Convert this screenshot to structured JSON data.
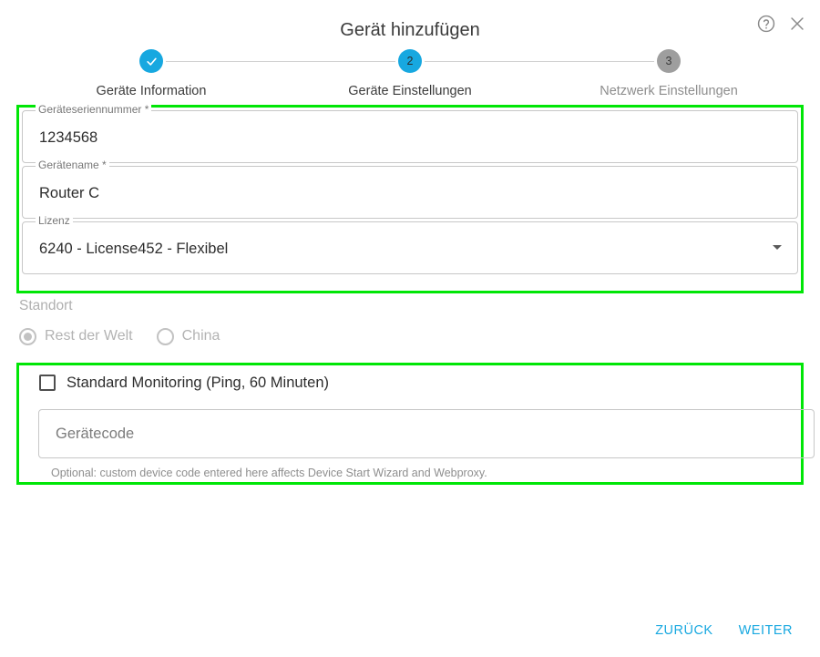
{
  "dialog": {
    "title": "Gerät hinzufügen",
    "help_icon": "help-circle-icon",
    "close_icon": "close-icon"
  },
  "colors": {
    "accent_blue": "#17a8e0",
    "highlight_green": "#00e606",
    "inactive_gray": "#9e9e9e",
    "disabled_text": "#b3b3b3"
  },
  "stepper": {
    "steps": [
      {
        "number": "1",
        "label": "Geräte Information",
        "state": "done",
        "glyph": "check-icon"
      },
      {
        "number": "2",
        "label": "Geräte Einstellungen",
        "state": "active",
        "glyph": "2"
      },
      {
        "number": "3",
        "label": "Netzwerk Einstellungen",
        "state": "todo",
        "glyph": "3"
      }
    ]
  },
  "device_group": {
    "serial": {
      "label": "Geräteseriennummer *",
      "value": "1234568",
      "placeholder": ""
    },
    "name": {
      "label": "Gerätename *",
      "value": "Router C",
      "placeholder": ""
    },
    "license": {
      "label": "Lizenz",
      "value": "6240 - License452 - Flexibel",
      "arrow_icon": "chevron-down-icon"
    }
  },
  "location": {
    "legend": "Standort",
    "options": [
      {
        "label": "Rest der Welt",
        "selected": true
      },
      {
        "label": "China",
        "selected": false
      }
    ]
  },
  "monitoring_group": {
    "checkbox_label": "Standard Monitoring (Ping, 60 Minuten)",
    "checkbox_checked": false,
    "device_code": {
      "placeholder": "Gerätecode",
      "value": ""
    },
    "helper_text": "Optional: custom device code entered here affects Device Start Wizard and Webproxy."
  },
  "footer": {
    "back_label": "ZURÜCK",
    "next_label": "WEITER"
  }
}
